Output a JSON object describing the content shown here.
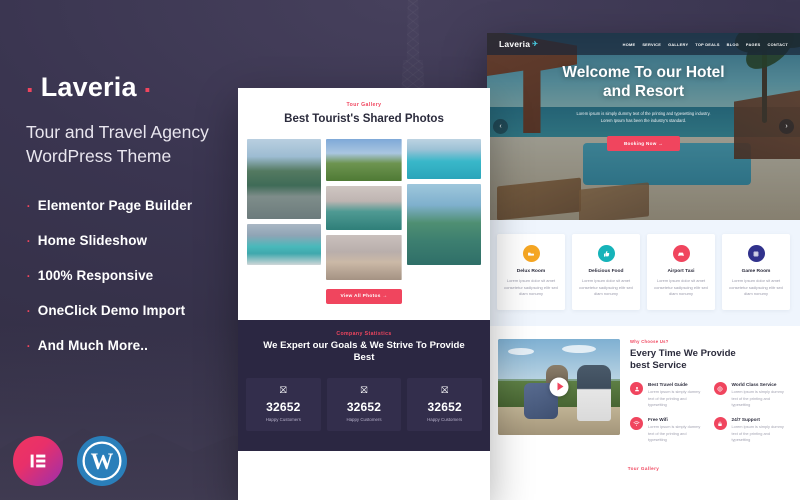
{
  "promo": {
    "brand": "Laveria",
    "brand_dot": ".",
    "tagline_line1": "Tour and Travel Agency",
    "tagline_line2": "WordPress Theme",
    "features": [
      {
        "bullet": ".",
        "label": "Elementor Page Builder"
      },
      {
        "bullet": ".",
        "label": "Home Slideshow"
      },
      {
        "bullet": ".",
        "label": "100% Responsive"
      },
      {
        "bullet": ".",
        "label": "OneClick Demo Import"
      },
      {
        "bullet": ".",
        "label": "And Much More.."
      }
    ],
    "badges": [
      {
        "name": "elementor-badge",
        "glyph": "☲"
      },
      {
        "name": "wordpress-badge",
        "glyph": "W"
      }
    ],
    "accent_color": "#f0455e",
    "background_color": "#373349"
  },
  "gallery_panel": {
    "section_label": "Tour Gallery",
    "title": "Best Tourist's Shared Photos",
    "view_all_label": "View All Photos  →",
    "stats": {
      "section_label": "Company Statistics",
      "title": "We Expert our Goals & We Strive To Provide Best",
      "items": [
        {
          "icon": "people-icon",
          "glyph": "⛝",
          "value": "32652",
          "label": "Happy Customers"
        },
        {
          "icon": "people-icon",
          "glyph": "⛝",
          "value": "32652",
          "label": "Happy Customers"
        },
        {
          "icon": "people-icon",
          "glyph": "⛝",
          "value": "32652",
          "label": "Happy Customers"
        }
      ]
    }
  },
  "site_panel": {
    "nav": {
      "logo": "Laveria",
      "logo_icon": "✈",
      "links": [
        "HOME",
        "SERVICE",
        "GALLERY",
        "TOP DEALS",
        "BLOG",
        "PAGES",
        "CONTACT"
      ]
    },
    "hero": {
      "heading_line1": "Welcome To our Hotel",
      "heading_line2": "and Resort",
      "paragraph_line1": "Lorem ipsum is simply dummy text of the printing and typesetting industry.",
      "paragraph_line2": "Lorem Ipsum has been the industry's standard.",
      "button_label": "Booking Now  →",
      "prev_arrow": "‹",
      "next_arrow": "›"
    },
    "services": {
      "cards": [
        {
          "icon": "bed-icon",
          "glyph": "🛏",
          "color": "#f5a623",
          "title": "Delux Room",
          "text": "Lorem ipsum dolor sit amet consetetur sadipscing elitr sed diam nonumy"
        },
        {
          "icon": "thumbs-up-icon",
          "glyph": "👍",
          "color": "#16b3b9",
          "title": "Delicious Food",
          "text": "Lorem ipsum dolor sit amet consetetur sadipscing elitr sed diam nonumy"
        },
        {
          "icon": "taxi-icon",
          "glyph": "🚖",
          "color": "#f0455e",
          "title": "Airport Taxi",
          "text": "Lorem ipsum dolor sit amet consetetur sadipscing elitr sed diam nonumy"
        },
        {
          "icon": "game-icon",
          "glyph": "🎰",
          "color": "#31328c",
          "title": "Game Room",
          "text": "Lorem ipsum dolor sit amet consetetur sadipscing elitr sed diam nonumy"
        }
      ]
    },
    "why": {
      "label": "Why Choose Us?",
      "heading_line1": "Every Time We Provide",
      "heading_line2": "best Service",
      "play_button": "play-button",
      "features": [
        {
          "icon": "guide-icon",
          "glyph": "👤",
          "title": "Best Travel Guide",
          "text": "Lorem ipsum is simply dummy text of the printing and typesetting"
        },
        {
          "icon": "globe-icon",
          "glyph": "🌐",
          "title": "World Class Service",
          "text": "Lorem ipsum is simply dummy text of the printing and typesetting"
        },
        {
          "icon": "wifi-icon",
          "glyph": "◔",
          "title": "Free Wifi",
          "text": "Lorem ipsum is simply dummy text of the printing and typesetting"
        },
        {
          "icon": "support-icon",
          "glyph": "🔒",
          "title": "24/7 Support",
          "text": "Lorem ipsum is simply dummy text of the printing and typesetting"
        }
      ]
    },
    "footer_label": "Tour Gallery"
  }
}
